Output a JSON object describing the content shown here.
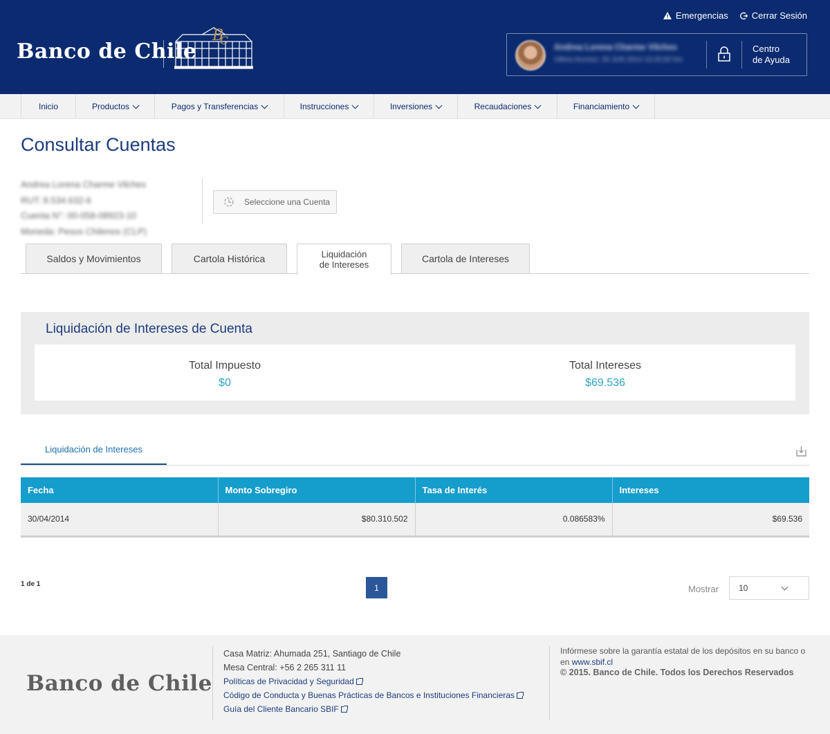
{
  "header": {
    "logo_text": "Banco de Chile",
    "emergencias": "Emergencias",
    "cerrar_sesion": "Cerrar Sesión",
    "user_name": "Andrea Lorena Charme Vilches",
    "user_access": "Último Acceso: 25 JUN 2014 13:20:00 hrs",
    "help_line1": "Centro",
    "help_line2": "de Ayuda"
  },
  "nav": {
    "items": [
      {
        "label": "Inicio"
      },
      {
        "label": "Productos"
      },
      {
        "label": "Pagos y Transferencias"
      },
      {
        "label": "Instrucciones"
      },
      {
        "label": "Inversiones"
      },
      {
        "label": "Recaudaciones"
      },
      {
        "label": "Financiamiento"
      }
    ]
  },
  "page": {
    "title": "Consultar Cuentas"
  },
  "account": {
    "name": "Andrea Lorena Charme Vilches",
    "rut": "RUT: 8.534.632-6",
    "cuenta": "Cuenta N°: 00-058-08923-10",
    "moneda": "Moneda: Pesos Chilenos (CLP)",
    "select_label": "Seleccione una Cuenta"
  },
  "tabs": [
    {
      "label": "Saldos y Movimientos"
    },
    {
      "label": "Cartola Histórica"
    },
    {
      "label_line1": "Liquidación",
      "label_line2": "de Intereses"
    },
    {
      "label": "Cartola de Intereses"
    }
  ],
  "summary": {
    "title": "Liquidación de Intereses de Cuenta",
    "total_impuesto_label": "Total Impuesto",
    "total_impuesto_value": "$0",
    "total_intereses_label": "Total Intereses",
    "total_intereses_value": "$69.536"
  },
  "section": {
    "tab_label": "Liquidación de Intereses"
  },
  "table": {
    "columns": [
      "Fecha",
      "Monto Sobregiro",
      "Tasa de Interés",
      "Intereses"
    ],
    "rows": [
      [
        "30/04/2014",
        "$80.310.502",
        "0.086583%",
        "$69.536"
      ]
    ]
  },
  "pagination": {
    "count": "1 de 1",
    "current_page": "1",
    "show_label": "Mostrar",
    "show_value": "10"
  },
  "footer": {
    "logo_text": "Banco de Chile",
    "address": "Casa Matriz: Ahumada 251, Santiago de Chile",
    "phone": "Mesa Central: +56 2 265 311 11",
    "link_privacy": "Políticas de Privacidad y Seguridad",
    "link_conduct": "Código de Conducta y Buenas Prácticas de Bancos e Instituciones Financieras",
    "link_guide": "Guía del Cliente Bancario SBIF",
    "info_text": "Infórmese sobre la garantía estatal de los depósitos en su banco o en",
    "info_site": "www.sbif.cl",
    "copyright": "© 2015. Banco de Chile. Todos los Derechos Reservados"
  },
  "colors": {
    "header_bg": "#0b2a6f",
    "accent_blue": "#159dcc",
    "value_cyan": "#2ea3c9",
    "page_button": "#2a5799"
  }
}
